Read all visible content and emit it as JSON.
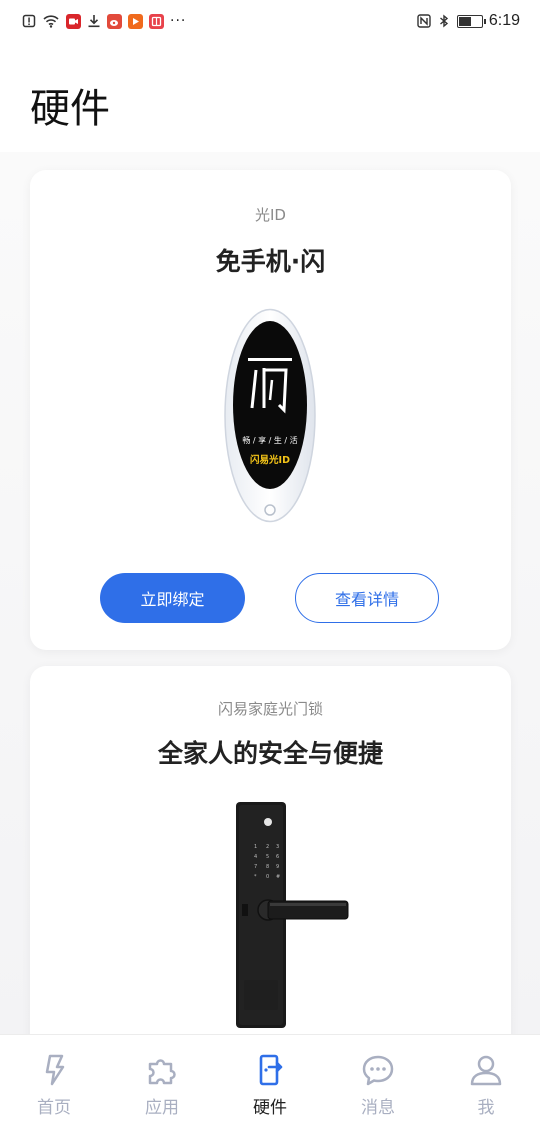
{
  "status_bar": {
    "time": "6:19",
    "battery_level": 0.55,
    "left_icons": [
      "alert-icon",
      "wifi-icon",
      "video-app-icon",
      "download-icon",
      "weibo-app-icon",
      "player-app-icon",
      "reader-app-icon"
    ],
    "more": "···"
  },
  "header": {
    "title": "硬件"
  },
  "cards": [
    {
      "subtitle": "光ID",
      "title": "免手机·闪",
      "device_text_main": "闪",
      "device_slogan": "畅 / 享 / 生 / 活",
      "device_brand": "闪易光ID",
      "primary_button": "立即绑定",
      "secondary_button": "查看详情"
    },
    {
      "subtitle": "闪易家庭光门锁",
      "title": "全家人的安全与便捷"
    }
  ],
  "tabbar": {
    "tabs": [
      {
        "label": "首页",
        "icon": "lightning-icon",
        "active": false
      },
      {
        "label": "应用",
        "icon": "puzzle-icon",
        "active": false
      },
      {
        "label": "硬件",
        "icon": "door-icon",
        "active": true
      },
      {
        "label": "消息",
        "icon": "chat-bubble-icon",
        "active": false
      },
      {
        "label": "我",
        "icon": "user-icon",
        "active": false
      }
    ]
  },
  "colors": {
    "accent": "#2f6fe8",
    "tab_inactive": "#a9afc1",
    "tab_active": "#222222"
  }
}
